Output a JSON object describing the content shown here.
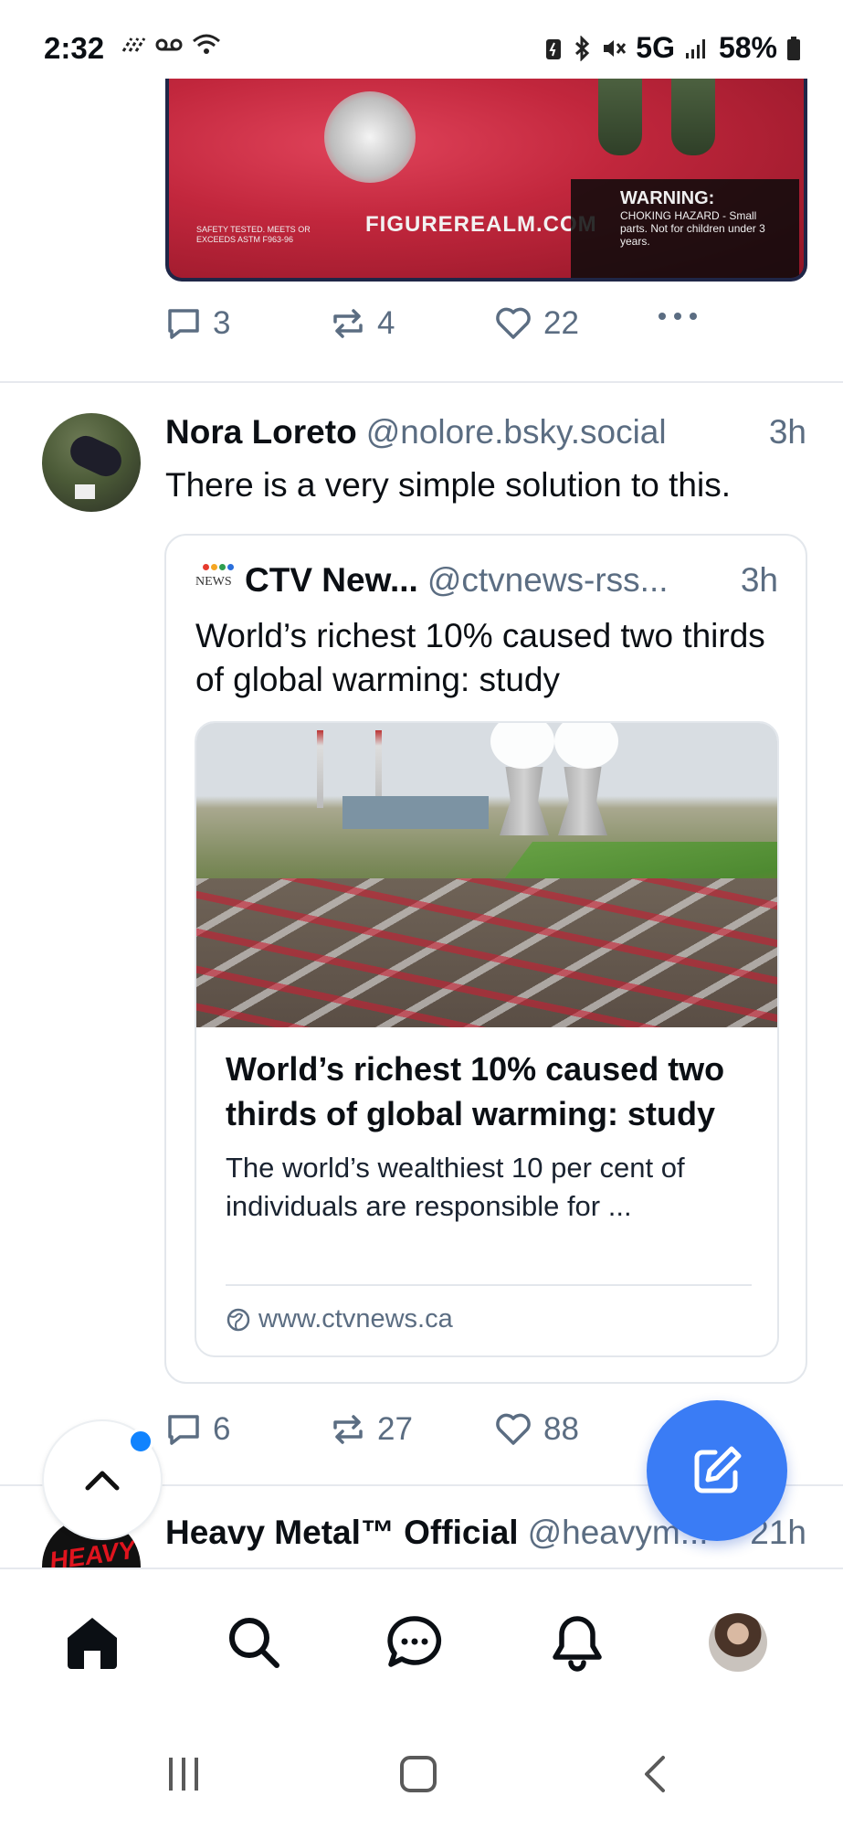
{
  "status_bar": {
    "time": "2:32",
    "network": "5G",
    "battery": "58%"
  },
  "previous_post": {
    "image": {
      "brand_text": "FIGUREREALM.COM",
      "warning_title": "WARNING:",
      "warning_body": "CHOKING HAZARD - Small parts. Not for children under 3 years.",
      "safety_text": "SAFETY TESTED. MEETS OR EXCEEDS ASTM F963-96"
    },
    "replies": "3",
    "reposts": "4",
    "likes": "22"
  },
  "post": {
    "author": "Nora Loreto",
    "handle": "@nolore.bsky.social",
    "time": "3h",
    "text": "There is a very simple solution to this.",
    "quote": {
      "logo_text": "NEWS",
      "author": "CTV New...",
      "handle": "@ctvnews-rss...",
      "time": "3h",
      "text": "World’s richest 10% caused two thirds of global warming: study",
      "link": {
        "title": "World’s richest 10% caused two thirds of global warming: study",
        "description": "The world’s wealthiest 10 per cent of individuals are responsible for ...",
        "domain": "www.ctvnews.ca"
      }
    },
    "replies": "6",
    "reposts": "27",
    "likes": "88"
  },
  "next_post": {
    "avatar_text": "HEAVY",
    "author": "Heavy Metal™ Official",
    "handle": "@heavym...",
    "time": "21h"
  },
  "colors": {
    "accent": "#3a7cf5",
    "muted": "#5b6d82",
    "new_indicator": "#1083fe"
  }
}
